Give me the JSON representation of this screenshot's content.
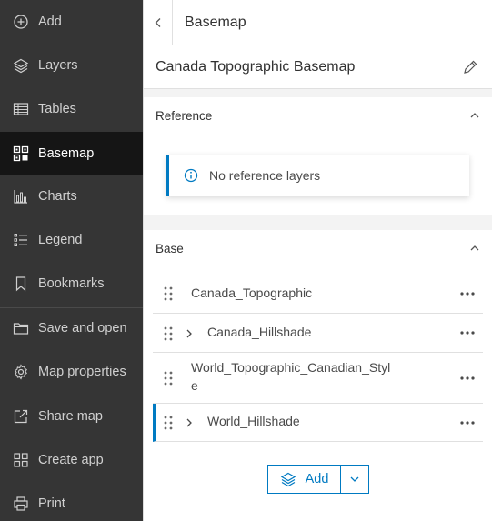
{
  "sidebar": {
    "items": [
      {
        "label": "Add",
        "icon": "plus-circle-icon"
      },
      {
        "label": "Layers",
        "icon": "layers-icon"
      },
      {
        "label": "Tables",
        "icon": "table-icon"
      },
      {
        "label": "Basemap",
        "icon": "basemap-icon",
        "active": true
      },
      {
        "label": "Charts",
        "icon": "bar-chart-icon"
      },
      {
        "label": "Legend",
        "icon": "legend-icon"
      },
      {
        "label": "Bookmarks",
        "icon": "bookmark-icon"
      },
      {
        "label": "Save and open",
        "icon": "folder-icon"
      },
      {
        "label": "Map properties",
        "icon": "gear-icon"
      },
      {
        "label": "Share map",
        "icon": "share-icon"
      },
      {
        "label": "Create app",
        "icon": "apps-grid-icon"
      },
      {
        "label": "Print",
        "icon": "printer-icon"
      }
    ]
  },
  "panel": {
    "header_title": "Basemap",
    "basemap_name": "Canada Topographic Basemap",
    "reference": {
      "title": "Reference",
      "notice": "No reference layers"
    },
    "base": {
      "title": "Base",
      "layers": [
        {
          "name": "Canada_Topographic",
          "expandable": false,
          "selected": false
        },
        {
          "name": "Canada_Hillshade",
          "expandable": true,
          "selected": false
        },
        {
          "name_line1": "World_Topographic_Canadian_Styl",
          "name_line2": "e",
          "expandable": false,
          "selected": false
        },
        {
          "name": "World_Hillshade",
          "expandable": true,
          "selected": true
        }
      ]
    },
    "add_button_label": "Add"
  },
  "colors": {
    "accent": "#007ac2",
    "sidebar_bg": "#353535",
    "sidebar_active": "#151515"
  }
}
